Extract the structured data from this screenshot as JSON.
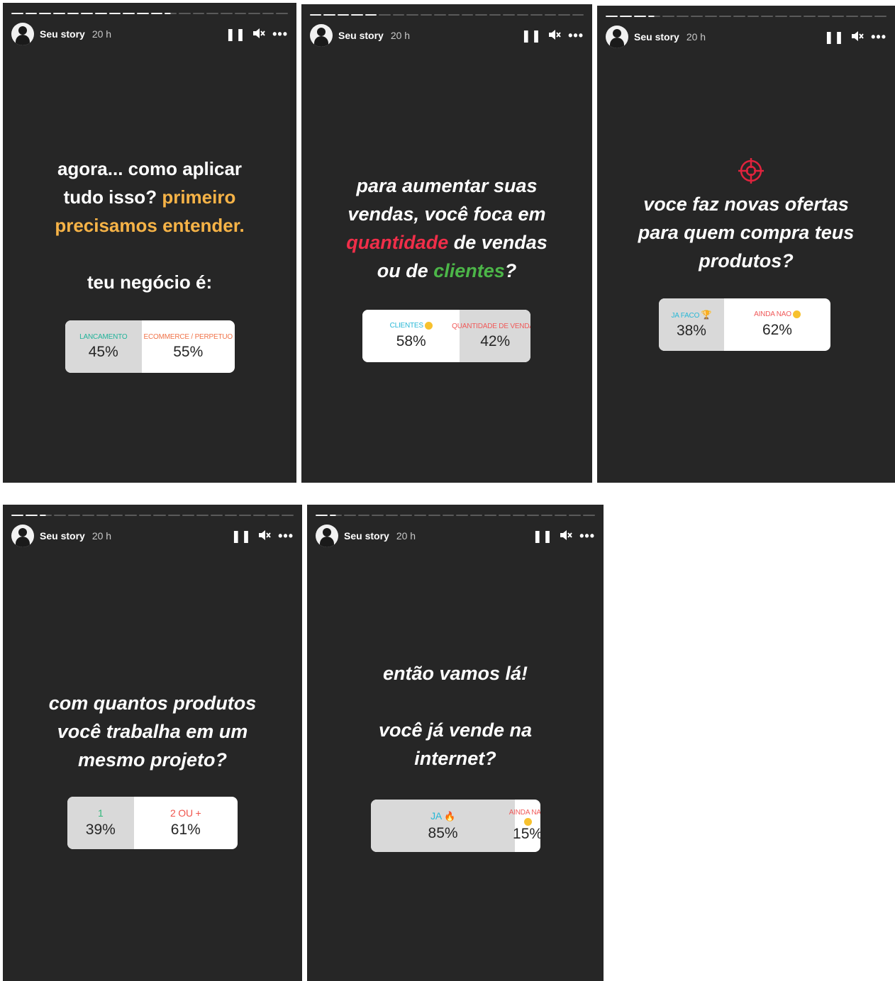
{
  "header": {
    "user": "Seu story",
    "time": "20 h"
  },
  "icons": {
    "pause": "pause-icon",
    "mute": "mute-icon",
    "more": "more-options-icon",
    "target": "target-icon"
  },
  "colors": {
    "bg": "#262626",
    "orange": "#f6b347",
    "red": "#f02e49",
    "green": "#4cb648"
  },
  "stories": [
    {
      "lines": [
        "agora... como aplicar",
        "tudo isso?",
        "primeiro",
        "precisamos entender.",
        "teu negócio é:"
      ],
      "poll": {
        "a_label": "LANCAMENTO",
        "a_pct": "45%",
        "a_val": 45,
        "b_label": "ECOMMERCE / PERPETUO",
        "b_pct": "55%"
      }
    },
    {
      "lines": [
        "para aumentar suas",
        "vendas, você foca em",
        "quantidade",
        "de vendas",
        "ou de",
        "clientes",
        "?"
      ],
      "poll": {
        "a_label": "CLIENTES",
        "a_pct": "58%",
        "a_val": 58,
        "b_label": "QUANTIDADE DE VENDAS",
        "b_pct": "42%"
      }
    },
    {
      "lines": [
        "voce faz novas ofertas",
        "para quem compra teus",
        "produtos?"
      ],
      "poll": {
        "a_label": "JA FACO",
        "a_pct": "38%",
        "a_val": 38,
        "b_label": "AINDA NAO",
        "b_pct": "62%"
      }
    },
    {
      "lines": [
        "com quantos produtos",
        "você trabalha em um",
        "mesmo projeto?"
      ],
      "poll": {
        "a_label": "1",
        "a_pct": "39%",
        "a_val": 39,
        "b_label": "2 OU +",
        "b_pct": "61%"
      }
    },
    {
      "lines": [
        "então vamos lá!",
        "você já vende na",
        "internet?"
      ],
      "poll": {
        "a_label": "JA",
        "a_pct": "85%",
        "a_val": 85,
        "b_label": "AINDA NAO",
        "b_pct": "15%"
      }
    }
  ]
}
